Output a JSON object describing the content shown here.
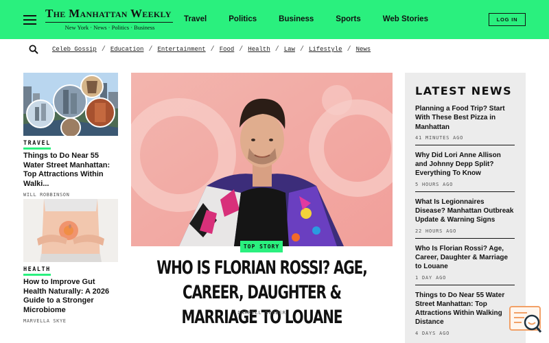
{
  "header": {
    "logo_title": "The Manhattan Weekly",
    "logo_tagline": "New York · News · Politics · Business",
    "nav": [
      "Travel",
      "Politics",
      "Business",
      "Sports",
      "Web Stories"
    ],
    "login_label": "LOG IN"
  },
  "subnav": {
    "links": [
      "Celeb Gossip",
      "Education",
      "Entertainment",
      "Food",
      "Health",
      "Law",
      "Lifestyle",
      "News"
    ],
    "separator": "/"
  },
  "left_cards": [
    {
      "category": "TRAVEL",
      "title": "Things to Do Near 55 Water Street Manhattan: Top Attractions Within Walki...",
      "author": "WILL ROBBINSON"
    },
    {
      "category": "HEALTH",
      "title": "How to Improve Gut Health Naturally: A 2026 Guide to a Stronger Microbiome",
      "author": "MARVELLA SKYE"
    }
  ],
  "hero": {
    "tag": "TOP STORY",
    "title": "WHO IS FLORIAN ROSSI? AGE, CAREER, DAUGHTER & MARRIAGE TO LOUANE",
    "author": "DARRELL SOUDER"
  },
  "latest": {
    "heading": "LATEST NEWS",
    "items": [
      {
        "title": "Planning a Food Trip? Start With These Best Pizza in Manhattan",
        "time": "41 MINUTES AGO"
      },
      {
        "title": "Why Did Lori Anne Allison and Johnny Depp Split? Everything To Know",
        "time": "5 HOURS AGO"
      },
      {
        "title": "What Is Legionnaires Disease? Manhattan Outbreak Update & Warning Signs",
        "time": "22 HOURS AGO"
      },
      {
        "title": "Who Is Florian Rossi? Age, Career, Daughter & Marriage to Louane",
        "time": "1 DAY AGO"
      },
      {
        "title": "Things to Do Near 55 Water Street Manhattan: Top Attractions Within Walking Distance",
        "time": "4 DAYS AGO"
      }
    ]
  },
  "colors": {
    "accent": "#2af07e",
    "sidebar_bg": "#ececec",
    "text": "#111111"
  },
  "icons": {
    "menu": "hamburger-icon",
    "search": "search-icon",
    "widget": "chat-search-icon"
  }
}
